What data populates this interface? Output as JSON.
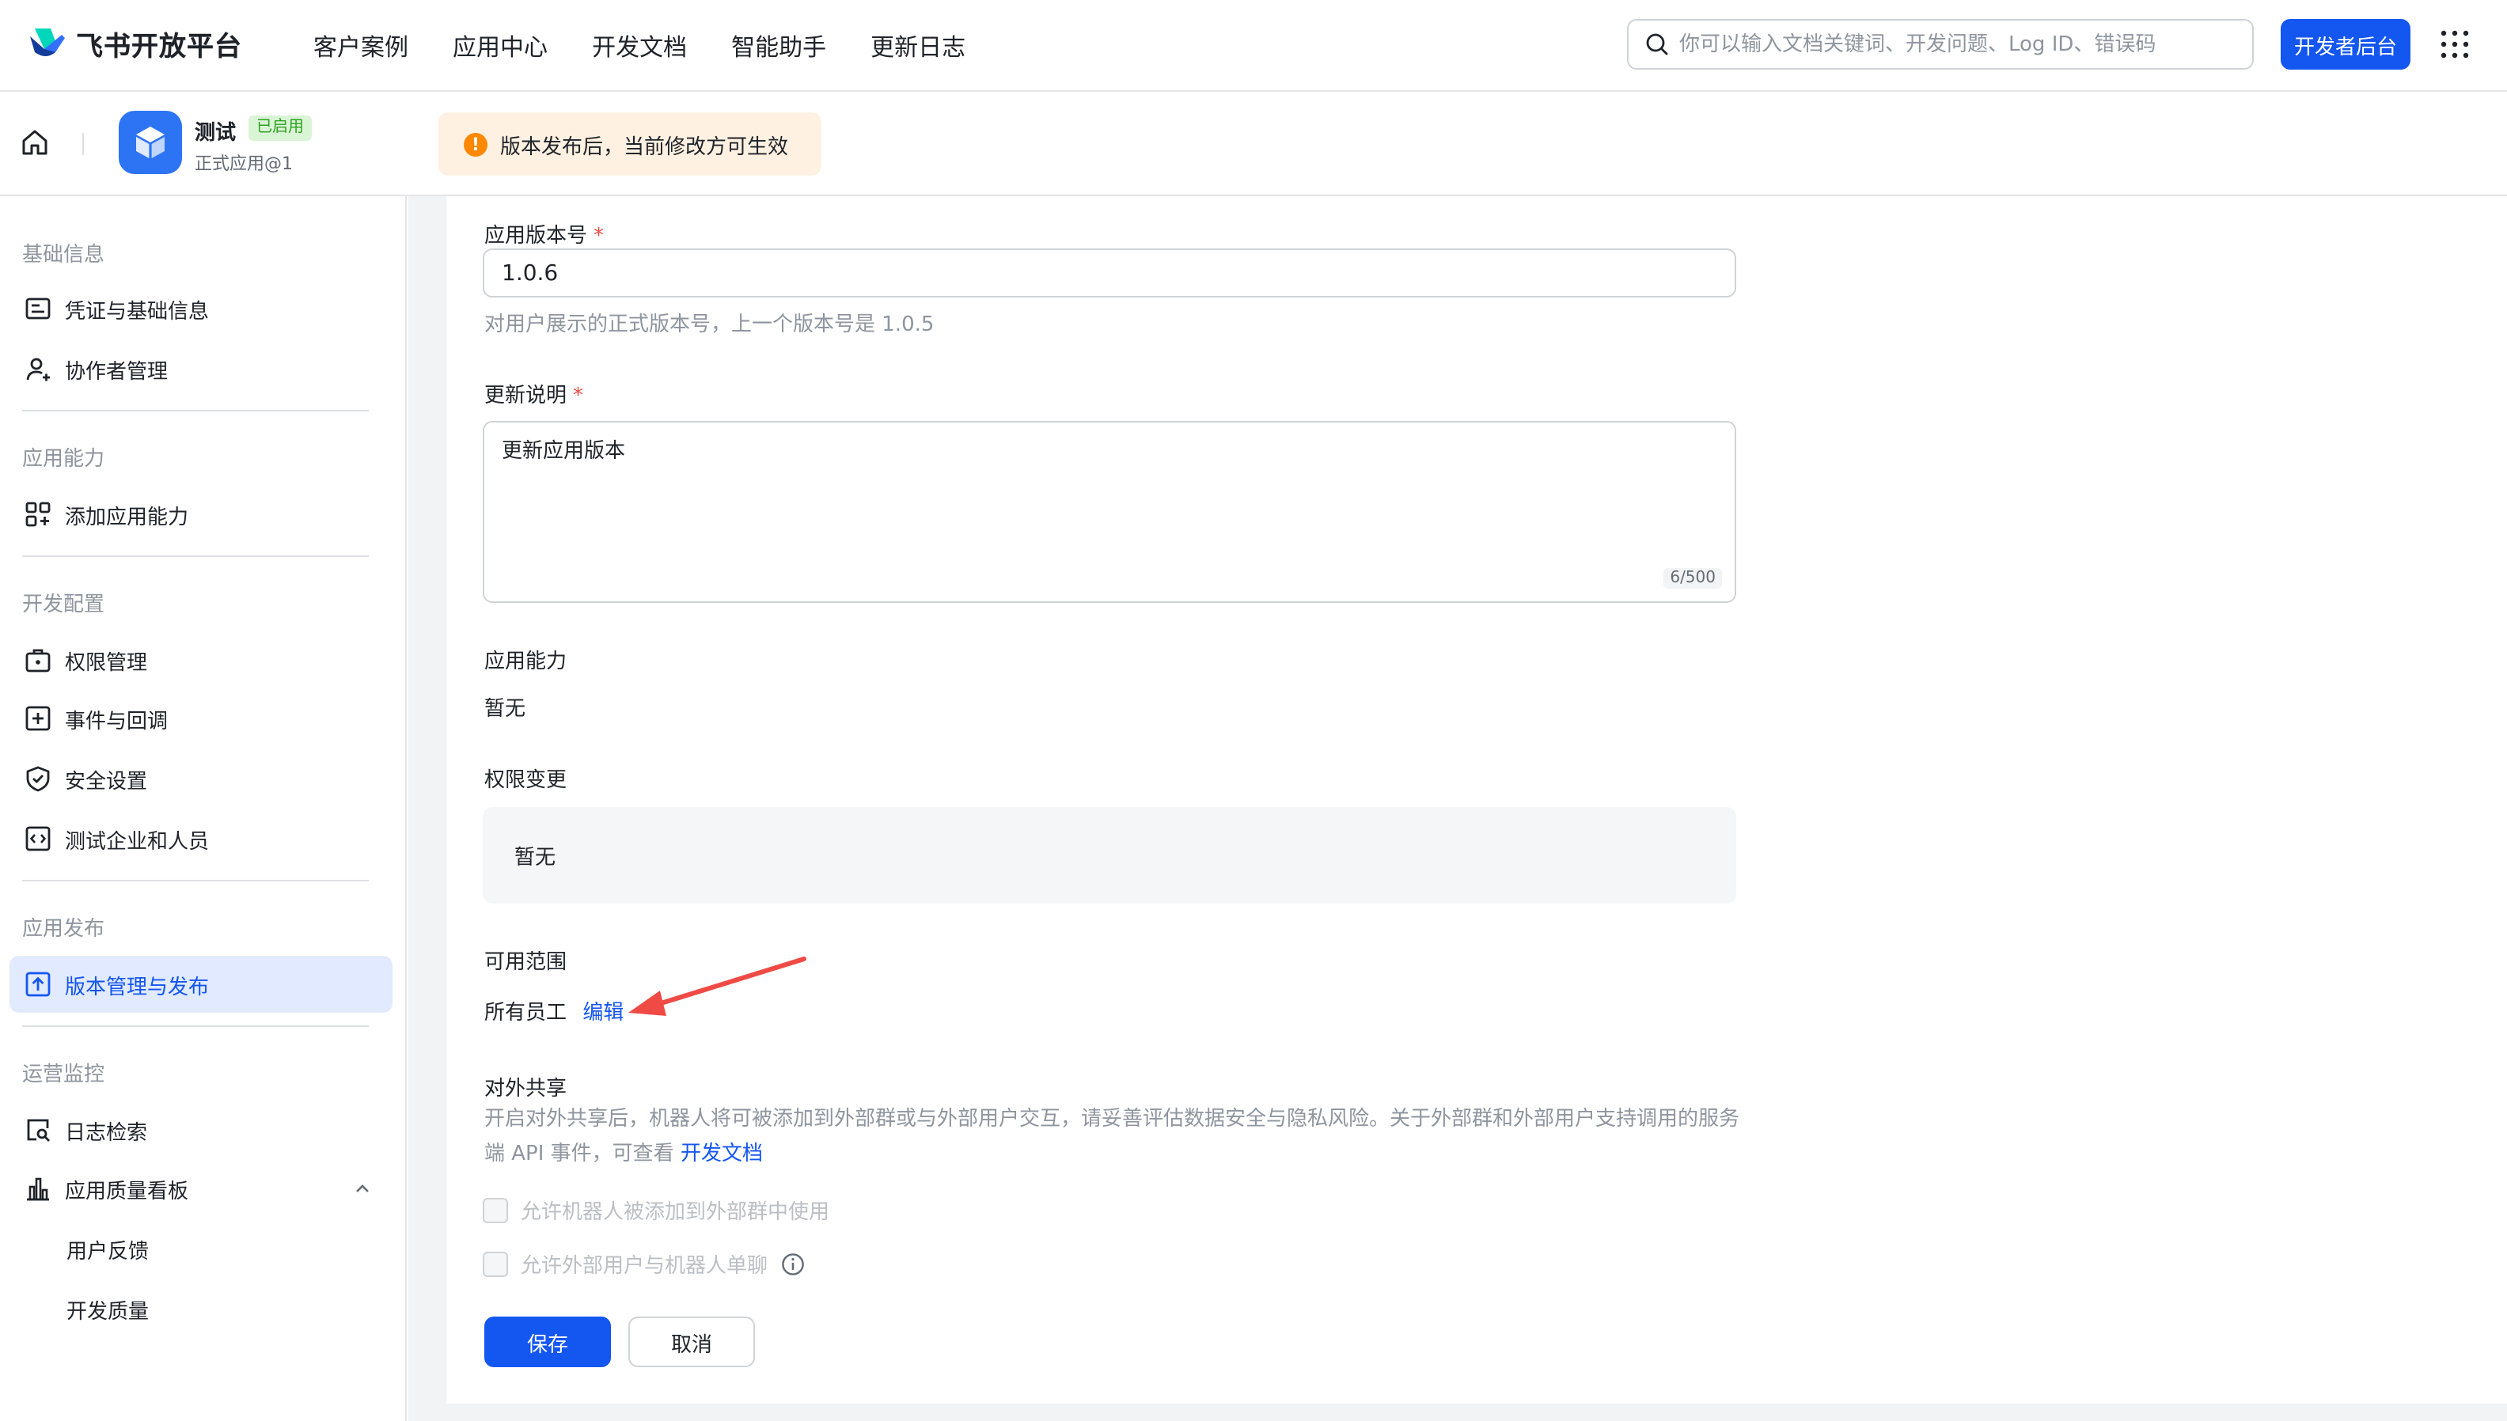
{
  "brand": {
    "name": "飞书开放平台"
  },
  "nav": {
    "items": [
      "客户案例",
      "应用中心",
      "开发文档",
      "智能助手",
      "更新日志"
    ]
  },
  "search": {
    "placeholder": "你可以输入文档关键词、开发问题、Log ID、错误码"
  },
  "header": {
    "dev_console": "开发者后台"
  },
  "app": {
    "name": "测试",
    "status": "已启用",
    "subtitle": "正式应用@1"
  },
  "notice": {
    "text": "版本发布后，当前修改方可生效",
    "icon": "!"
  },
  "sidebar": {
    "sections": [
      {
        "title": "基础信息",
        "items": [
          "凭证与基础信息",
          "协作者管理"
        ]
      },
      {
        "title": "应用能力",
        "items": [
          "添加应用能力"
        ]
      },
      {
        "title": "开发配置",
        "items": [
          "权限管理",
          "事件与回调",
          "安全设置",
          "测试企业和人员"
        ]
      },
      {
        "title": "应用发布",
        "items": [
          "版本管理与发布"
        ]
      },
      {
        "title": "运营监控",
        "items": [
          "日志检索",
          "应用质量看板",
          "用户反馈",
          "开发质量"
        ]
      }
    ],
    "active_item": "版本管理与发布"
  },
  "form": {
    "version": {
      "label": "应用版本号",
      "required_mark": "*",
      "value": "1.0.6",
      "hint": "对用户展示的正式版本号，上一个版本号是 1.0.5"
    },
    "notes": {
      "label": "更新说明",
      "required_mark": "*",
      "value": "更新应用版本",
      "counter": "6/500"
    },
    "abilities": {
      "label": "应用能力",
      "value": "暂无"
    },
    "permission_changes": {
      "label": "权限变更",
      "value": "暂无"
    },
    "scope": {
      "label": "可用范围",
      "value": "所有员工",
      "edit_link": "编辑"
    },
    "external_share": {
      "label": "对外共享",
      "desc_part1": "开启对外共享后，机器人将可被添加到外部群或与外部用户交互，请妥善评估数据安全与隐私风险。关于外部群和外部用户支持调用的服务端 API 事件，可查看",
      "desc_link": "开发文档",
      "options": [
        "允许机器人被添加到外部群中使用",
        "允许外部用户与机器人单聊"
      ]
    },
    "save": "保存",
    "cancel": "取消"
  },
  "colors": {
    "primary": "#1456f0",
    "active_bg": "#e1eaff",
    "annotation_arrow": "#f04a45",
    "notice_bg": "#fef1e1",
    "warning": "#ff8800"
  }
}
